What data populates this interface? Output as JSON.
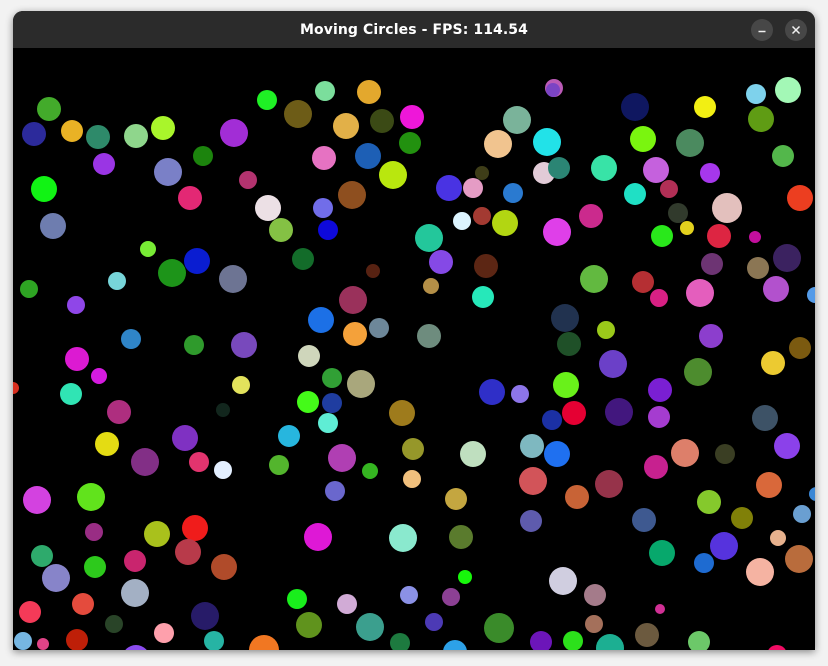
{
  "window": {
    "title": "Moving Circles - FPS: 114.54",
    "minimize_icon": "minimize-icon",
    "close_icon": "close-icon"
  },
  "canvas": {
    "background": "#000000",
    "circles": [
      [
        "#43ab2b",
        36,
        61,
        12
      ],
      [
        "#2c2a9b",
        21,
        86,
        12
      ],
      [
        "#e9b225",
        59,
        83,
        11
      ],
      [
        "#2e8a6a",
        85,
        89,
        12
      ],
      [
        "#8fd68c",
        123,
        88,
        12
      ],
      [
        "#a9f52b",
        150,
        80,
        12
      ],
      [
        "#1ff025",
        254,
        52,
        10
      ],
      [
        "#6d5c17",
        285,
        66,
        14
      ],
      [
        "#7bde9c",
        312,
        43,
        10
      ],
      [
        "#e3a82d",
        356,
        44,
        12
      ],
      [
        "#e2b048",
        333,
        78,
        13
      ],
      [
        "#3b4a15",
        369,
        73,
        12
      ],
      [
        "#ee17d9",
        399,
        69,
        12
      ],
      [
        "#bb5ab7",
        541,
        40,
        9
      ],
      [
        "#7b44c4",
        540,
        42,
        7
      ],
      [
        "#a22dd6",
        221,
        85,
        14
      ],
      [
        "#1c840d",
        190,
        108,
        10
      ],
      [
        "#9a35e4",
        91,
        116,
        11
      ],
      [
        "#7a80c7",
        155,
        124,
        14
      ],
      [
        "#e32874",
        177,
        150,
        12
      ],
      [
        "#b3336f",
        235,
        132,
        9
      ],
      [
        "#22910f",
        397,
        95,
        11
      ],
      [
        "#1d5fb5",
        355,
        108,
        13
      ],
      [
        "#e672c2",
        311,
        110,
        12
      ],
      [
        "#b9e70e",
        380,
        127,
        14
      ],
      [
        "#3e3d18",
        469,
        125,
        7
      ],
      [
        "#f1c48f",
        485,
        96,
        14
      ],
      [
        "#7ab39a",
        504,
        72,
        14
      ],
      [
        "#22e2e8",
        534,
        94,
        14
      ],
      [
        "#0f1760",
        622,
        59,
        14
      ],
      [
        "#f2ef13",
        692,
        59,
        11
      ],
      [
        "#7ed2ec",
        743,
        46,
        10
      ],
      [
        "#5f9c14",
        748,
        71,
        13
      ],
      [
        "#a3f8b6",
        775,
        42,
        13
      ],
      [
        "#7af50f",
        630,
        91,
        13
      ],
      [
        "#4b8a5f",
        677,
        95,
        14
      ],
      [
        "#a637ec",
        697,
        125,
        10
      ],
      [
        "#53b74b",
        770,
        108,
        11
      ],
      [
        "#ec3e20",
        787,
        150,
        13
      ],
      [
        "#c561dd",
        643,
        122,
        13
      ],
      [
        "#b22f56",
        656,
        141,
        9
      ],
      [
        "#1fe0c5",
        622,
        146,
        11
      ],
      [
        "#38e3a7",
        591,
        120,
        13
      ],
      [
        "#11f314",
        31,
        141,
        13
      ],
      [
        "#8e4f1f",
        339,
        147,
        14
      ],
      [
        "#716de9",
        310,
        160,
        10
      ],
      [
        "#4933e3",
        436,
        140,
        13
      ],
      [
        "#e59cc5",
        460,
        140,
        10
      ],
      [
        "#e2cbd7",
        531,
        125,
        11
      ],
      [
        "#2b8574",
        546,
        120,
        11
      ],
      [
        "#a33a32",
        469,
        168,
        9
      ],
      [
        "#dcf4ff",
        449,
        173,
        9
      ],
      [
        "#b2d612",
        492,
        175,
        13
      ],
      [
        "#2a7ad0",
        500,
        145,
        10
      ],
      [
        "#313a2c",
        665,
        165,
        10
      ],
      [
        "#e2d11e",
        674,
        180,
        7
      ],
      [
        "#cb2a8d",
        578,
        168,
        12
      ],
      [
        "#6e7daf",
        40,
        178,
        13
      ],
      [
        "#ece0e5",
        255,
        160,
        13
      ],
      [
        "#84c144",
        268,
        182,
        12
      ],
      [
        "#0e09db",
        315,
        182,
        10
      ],
      [
        "#23c79b",
        416,
        190,
        14
      ],
      [
        "#df3fe9",
        544,
        184,
        14
      ],
      [
        "#29e81b",
        649,
        188,
        11
      ],
      [
        "#dd2542",
        706,
        188,
        12
      ],
      [
        "#e3c0bd",
        714,
        160,
        15
      ],
      [
        "#c20f9d",
        742,
        189,
        6
      ],
      [
        "#3b2260",
        774,
        210,
        14
      ],
      [
        "#6d3473",
        699,
        216,
        11
      ],
      [
        "#8b7654",
        745,
        220,
        11
      ],
      [
        "#78eb35",
        135,
        201,
        8
      ],
      [
        "#0a1dd1",
        184,
        213,
        13
      ],
      [
        "#136c2a",
        290,
        211,
        11
      ],
      [
        "#1d9419",
        159,
        225,
        14
      ],
      [
        "#6d7493",
        220,
        231,
        14
      ],
      [
        "#77d5d9",
        104,
        233,
        9
      ],
      [
        "#2ea423",
        16,
        241,
        9
      ],
      [
        "#8549e6",
        428,
        214,
        12
      ],
      [
        "#572212",
        360,
        223,
        7
      ],
      [
        "#5c2614",
        473,
        218,
        12
      ],
      [
        "#b48f47",
        418,
        238,
        8
      ],
      [
        "#26e8ba",
        470,
        249,
        11
      ],
      [
        "#62b940",
        581,
        231,
        14
      ],
      [
        "#b52f33",
        630,
        234,
        11
      ],
      [
        "#d82084",
        646,
        250,
        9
      ],
      [
        "#e45ebd",
        687,
        245,
        14
      ],
      [
        "#b251cd",
        763,
        241,
        13
      ],
      [
        "#549be8",
        802,
        247,
        8
      ],
      [
        "#8f46e8",
        63,
        257,
        9
      ],
      [
        "#9a315b",
        340,
        252,
        14
      ],
      [
        "#1c70e6",
        308,
        272,
        13
      ],
      [
        "#f4a13a",
        342,
        286,
        12
      ],
      [
        "#6d8799",
        366,
        280,
        10
      ],
      [
        "#6e8c7e",
        416,
        288,
        12
      ],
      [
        "#21324f",
        552,
        270,
        14
      ],
      [
        "#1f5028",
        556,
        296,
        12
      ],
      [
        "#9ac91a",
        593,
        282,
        9
      ],
      [
        "#8c3ecd",
        698,
        288,
        12
      ],
      [
        "#ecca31",
        760,
        315,
        12
      ],
      [
        "#7b5a10",
        787,
        300,
        11
      ],
      [
        "#2f85c8",
        118,
        291,
        10
      ],
      [
        "#2f9a2c",
        181,
        297,
        10
      ],
      [
        "#7849bc",
        231,
        297,
        13
      ],
      [
        "#cfd6bb",
        296,
        308,
        11
      ],
      [
        "#dc1ad2",
        64,
        311,
        12
      ],
      [
        "#d51bdf",
        86,
        328,
        8
      ],
      [
        "#6b40c8",
        600,
        316,
        14
      ],
      [
        "#4d8c2e",
        685,
        324,
        14
      ],
      [
        "#2f2fc8",
        479,
        344,
        13
      ],
      [
        "#8d75e9",
        507,
        346,
        9
      ],
      [
        "#69f11a",
        553,
        337,
        13
      ],
      [
        "#31a035",
        319,
        330,
        10
      ],
      [
        "#1f3da0",
        319,
        355,
        10
      ],
      [
        "#a9a77c",
        348,
        336,
        14
      ],
      [
        "#e2e25c",
        228,
        337,
        9
      ],
      [
        "#30e4b4",
        58,
        346,
        11
      ],
      [
        "#ae2e7f",
        106,
        364,
        12
      ],
      [
        "#12261d",
        210,
        362,
        7
      ],
      [
        "#44fb19",
        295,
        354,
        11
      ],
      [
        "#d72f1f",
        0,
        340,
        6
      ],
      [
        "#5fedd5",
        315,
        375,
        10
      ],
      [
        "#9e7b1c",
        389,
        365,
        13
      ],
      [
        "#1b30a4",
        539,
        372,
        10
      ],
      [
        "#e50033",
        561,
        365,
        12
      ],
      [
        "#42177e",
        606,
        364,
        14
      ],
      [
        "#a53cd0",
        646,
        369,
        11
      ],
      [
        "#7a1fd3",
        647,
        342,
        12
      ],
      [
        "#3d5266",
        752,
        370,
        13
      ],
      [
        "#e4dc13",
        94,
        396,
        12
      ],
      [
        "#7f31c2",
        172,
        390,
        13
      ],
      [
        "#e3346e",
        186,
        414,
        10
      ],
      [
        "#27b6de",
        276,
        388,
        11
      ],
      [
        "#96972a",
        400,
        401,
        11
      ],
      [
        "#bfdfbf",
        460,
        406,
        13
      ],
      [
        "#7eb8c0",
        519,
        398,
        12
      ],
      [
        "#1f70f0",
        544,
        406,
        13
      ],
      [
        "#dd7f6a",
        672,
        405,
        14
      ],
      [
        "#3a3e23",
        712,
        406,
        10
      ],
      [
        "#8b41ea",
        774,
        398,
        13
      ],
      [
        "#822f86",
        132,
        414,
        14
      ],
      [
        "#b03fb3",
        329,
        410,
        14
      ],
      [
        "#53b52d",
        266,
        417,
        10
      ],
      [
        "#e3efff",
        210,
        422,
        9
      ],
      [
        "#35b521",
        357,
        423,
        8
      ],
      [
        "#f1c07d",
        399,
        431,
        9
      ],
      [
        "#d25459",
        520,
        433,
        14
      ],
      [
        "#96334a",
        596,
        436,
        14
      ],
      [
        "#c7218f",
        643,
        419,
        12
      ],
      [
        "#c86336",
        564,
        449,
        12
      ],
      [
        "#d342e0",
        24,
        452,
        14
      ],
      [
        "#61e31c",
        78,
        449,
        14
      ],
      [
        "#6a67cd",
        322,
        443,
        10
      ],
      [
        "#c4a640",
        443,
        451,
        11
      ],
      [
        "#85c92c",
        696,
        454,
        12
      ],
      [
        "#d9683a",
        756,
        437,
        13
      ],
      [
        "#3b87d5",
        803,
        446,
        7
      ],
      [
        "#992d84",
        81,
        484,
        9
      ],
      [
        "#a9c11c",
        144,
        486,
        13
      ],
      [
        "#f01c1b",
        182,
        480,
        13
      ],
      [
        "#de18d6",
        305,
        489,
        14
      ],
      [
        "#8ae9ce",
        390,
        490,
        14
      ],
      [
        "#5a7b2d",
        448,
        489,
        12
      ],
      [
        "#5e5bad",
        518,
        473,
        11
      ],
      [
        "#3e5990",
        631,
        472,
        12
      ],
      [
        "#808008",
        729,
        470,
        11
      ],
      [
        "#6a9fd1",
        789,
        466,
        9
      ],
      [
        "#2eaa6c",
        29,
        508,
        11
      ],
      [
        "#b83a4a",
        175,
        504,
        13
      ],
      [
        "#b04b2a",
        211,
        519,
        13
      ],
      [
        "#2dc91c",
        82,
        519,
        11
      ],
      [
        "#c9256e",
        122,
        513,
        11
      ],
      [
        "#8784c9",
        43,
        530,
        14
      ],
      [
        "#07a86c",
        649,
        505,
        13
      ],
      [
        "#5633dd",
        711,
        498,
        14
      ],
      [
        "#e7b18d",
        765,
        490,
        8
      ],
      [
        "#b96c3c",
        786,
        511,
        14
      ],
      [
        "#1e6bd1",
        691,
        515,
        10
      ],
      [
        "#f5b3a2",
        747,
        524,
        14
      ],
      [
        "#a3b0c4",
        122,
        545,
        14
      ],
      [
        "#19ee1c",
        284,
        551,
        10
      ],
      [
        "#d1abd6",
        334,
        556,
        10
      ],
      [
        "#8b91e6",
        396,
        547,
        9
      ],
      [
        "#8c4094",
        438,
        549,
        9
      ],
      [
        "#17f70b",
        452,
        529,
        7
      ],
      [
        "#d0cee0",
        550,
        533,
        14
      ],
      [
        "#a47b8a",
        582,
        547,
        11
      ],
      [
        "#d13095",
        647,
        561,
        5
      ],
      [
        "#f43a58",
        17,
        564,
        11
      ],
      [
        "#e44b3d",
        70,
        556,
        11
      ],
      [
        "#271b68",
        192,
        568,
        14
      ],
      [
        "#294428",
        101,
        576,
        9
      ],
      [
        "#60931d",
        296,
        577,
        13
      ],
      [
        "#3b9f8e",
        357,
        579,
        14
      ],
      [
        "#4c3ab5",
        421,
        574,
        9
      ],
      [
        "#3a8b2a",
        486,
        580,
        15
      ],
      [
        "#a4705b",
        581,
        576,
        9
      ],
      [
        "#6c5a3f",
        634,
        587,
        12
      ],
      [
        "#fea0ac",
        151,
        585,
        10
      ],
      [
        "#76b6e2",
        10,
        593,
        9
      ],
      [
        "#e04387",
        30,
        596,
        6
      ],
      [
        "#be1f08",
        64,
        592,
        11
      ],
      [
        "#26b4a4",
        201,
        593,
        10
      ],
      [
        "#f17722",
        251,
        602,
        15
      ],
      [
        "#1d7a3f",
        387,
        595,
        10
      ],
      [
        "#2da1e8",
        442,
        604,
        12
      ],
      [
        "#6c15b9",
        528,
        594,
        11
      ],
      [
        "#2ce01b",
        560,
        593,
        10
      ],
      [
        "#1caf92",
        597,
        600,
        14
      ],
      [
        "#6cc869",
        686,
        594,
        11
      ],
      [
        "#f00c64",
        764,
        607,
        10
      ],
      [
        "#8b4cef",
        123,
        611,
        14
      ],
      [
        "#192434",
        54,
        626,
        13
      ],
      [
        "#c36b25",
        194,
        625,
        8
      ],
      [
        "#3a4fdd",
        324,
        632,
        10
      ],
      [
        "#bc43c7",
        348,
        621,
        13
      ],
      [
        "#a0207a",
        386,
        617,
        11
      ],
      [
        "#7e1e8f",
        441,
        628,
        9
      ]
    ]
  }
}
